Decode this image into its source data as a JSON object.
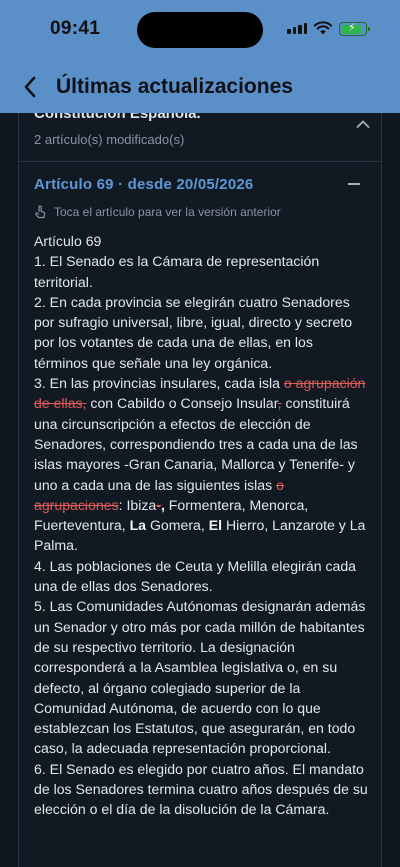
{
  "status_bar": {
    "time": "09:41"
  },
  "header": {
    "title": "Últimas actualizaciones"
  },
  "law": {
    "title": "Constitución Española.",
    "modified_count": "2 artículo(s) modificado(s)"
  },
  "article": {
    "heading": "Artículo 69 · desde 20/05/2026",
    "hint": "Toca el artículo para ver la versión anterior",
    "name": "Artículo 69",
    "p1": "1. El Senado es la Cámara de representación territorial.",
    "p2": "2. En cada provincia se elegirán cuatro Senadores por sufragio universal, libre, igual, directo y secreto por los votantes de cada una de ellas, en los términos que señale una ley orgánica.",
    "p3_a": "3. En las provincias insulares, cada isla ",
    "p3_del1": "o agrupación de ellas,",
    "p3_b": " con Cabildo o Consejo Insular",
    "p3_del2": ",",
    "p3_c": " constituirá una circunscripción a efectos de elección de Senadores, correspondiendo tres a cada una de las islas mayores -Gran Canaria, Mallorca y Tenerife- y uno a cada una de las siguientes islas ",
    "p3_del3": "o agrupaciones",
    "p3_d": ": Ibiza",
    "p3_del4": "-",
    "p3_ins1": ",",
    "p3_e": " Formentera, Menorca, Fuerteventura, ",
    "p3_ins2": "La",
    "p3_f": " Gomera, ",
    "p3_ins3": "El",
    "p3_g": " Hierro, Lanzarote y La Palma.",
    "p4": "4. Las poblaciones de Ceuta y Melilla elegirán cada una de ellas dos Senadores.",
    "p5": "5. Las Comunidades Autónomas designarán además un Senador y otro más por cada millón de habitantes de su respectivo territorio. La designación corresponderá a la Asamblea legislativa o, en su defecto, al órgano colegiado superior de la Comunidad Autónoma, de acuerdo con lo que establezcan los Estatutos, que asegurarán, en todo caso, la adecuada representación proporcional.",
    "p6": "6. El Senado es elegido por cuatro años. El mandato de los Senadores termina cuatro años después de su elección o el día de la disolución de la Cámara."
  },
  "colors": {
    "header_bg": "#5a8fc7",
    "accent": "#5b9ad7",
    "deleted": "#e05c56",
    "background": "#0f1720"
  }
}
